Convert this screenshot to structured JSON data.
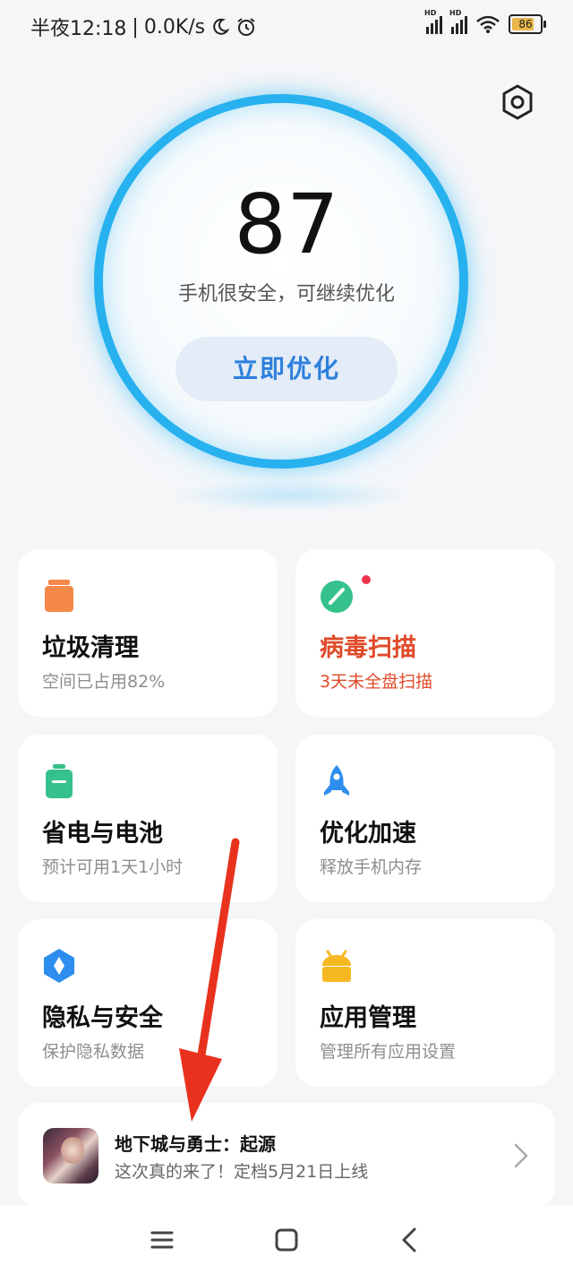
{
  "status": {
    "time": "半夜12:18",
    "net_speed": "0.0K/s",
    "battery": "86",
    "signal_label": "HD"
  },
  "header": {
    "settings_icon": "settings-hex-icon"
  },
  "score": {
    "value": "87",
    "description": "手机很安全，可继续优化",
    "button": "立即优化",
    "ring_color": "#27b1ef"
  },
  "cards": [
    {
      "title": "垃圾清理",
      "subtitle": "空间已占用82%",
      "icon": "trash-icon",
      "color": "#f5894a"
    },
    {
      "title": "病毒扫描",
      "subtitle": "3天未全盘扫描",
      "icon": "virus-scan-icon",
      "color": "#35c18b",
      "alert": true
    },
    {
      "title": "省电与电池",
      "subtitle": "预计可用1天1小时",
      "icon": "battery-icon",
      "color": "#35c18b"
    },
    {
      "title": "优化加速",
      "subtitle": "释放手机内存",
      "icon": "rocket-icon",
      "color": "#2e8ef0"
    },
    {
      "title": "隐私与安全",
      "subtitle": "保护隐私数据",
      "icon": "privacy-shield-icon",
      "color": "#2e8ef0"
    },
    {
      "title": "应用管理",
      "subtitle": "管理所有应用设置",
      "icon": "android-icon",
      "color": "#f5b821"
    }
  ],
  "promo": {
    "title": "地下城与勇士：起源",
    "subtitle": "这次真的来了！定档5月21日上线"
  },
  "navbar": {
    "menu_icon": "menu-icon",
    "home_icon": "home-icon",
    "back_icon": "back-icon"
  },
  "colors": {
    "accent_blue": "#2d7fdc",
    "alert_red": "#e04a2a",
    "arrow_red": "#e8321e"
  }
}
